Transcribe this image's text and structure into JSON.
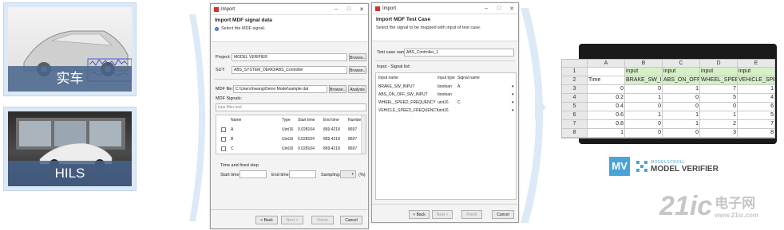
{
  "left": {
    "car_caption": "实车",
    "hils_caption": "HILS"
  },
  "dialog1": {
    "title": "Import",
    "header_title": "Import MDF signal data",
    "header_msg": "Select the MDF signal.",
    "project_label": "Project:",
    "project_value": "MODEL VERIFIER",
    "sut_label": "SUT:",
    "sut_value": "ABS_SYSTEM_DEMO/ABS_Controller",
    "browse1": "Browse...",
    "browse2": "Browse...",
    "mdf_file_label": "MDF file:",
    "mdf_file_value": "C:\\Users\\hwang\\Demo Model\\sample.dat",
    "browse3": "Browse...",
    "analysis": "Analysis",
    "mdf_signals_label": "MDF Signals:",
    "filter_placeholder": "type filter text",
    "columns": [
      "Name",
      "Type",
      "Start time",
      "End time",
      "Number"
    ],
    "rows": [
      [
        "A",
        "Uint16",
        "0.028104",
        "869.4218",
        "8697"
      ],
      [
        "B",
        "Uint16",
        "0.028104",
        "869.4218",
        "8697"
      ],
      [
        "C",
        "Uint16",
        "0.028104",
        "869.4218",
        "8697"
      ]
    ],
    "time_section": "Time and fixed step",
    "start_time_label": "Start time:",
    "end_time_label": "End time:",
    "sampling_label": "Sampling:",
    "sampling_unit": "(%)",
    "back": "< Back",
    "next": "Next >",
    "finish": "Finish",
    "cancel": "Cancel"
  },
  "dialog2": {
    "title": "Import",
    "header_title": "Import MDF Test Case",
    "header_msg": "Select the signal to be mapped with input of test case.",
    "test_case_label": "Test case name:",
    "test_case_value": "ABS_Controller_1",
    "section": "Input - Signal list:",
    "columns": [
      "Input name",
      "Input type",
      "Signal name"
    ],
    "rows": [
      [
        "BRAKE_SW_INPUT",
        "boolean",
        "A"
      ],
      [
        "ABS_ON_OFF_SW_INPUT",
        "boolean",
        ""
      ],
      [
        "WHEEL_SPEED_FREQUENCY",
        "uint16",
        "C"
      ],
      [
        "VEHICLE_SPEED_FREQUENCY",
        "uint16",
        ""
      ]
    ],
    "back": "< Back",
    "next": "Next >",
    "finish": "Finish",
    "cancel": "Cancel"
  },
  "sheet": {
    "col_headers": [
      "A",
      "B",
      "C",
      "D",
      "E"
    ],
    "row_numbers": [
      "1",
      "2",
      "3",
      "4",
      "5",
      "6",
      "7",
      "8"
    ],
    "rows": [
      [
        "",
        "input",
        "input",
        "input",
        "input"
      ],
      [
        "Time",
        "BRAKE_SW_INPUT",
        "ABS_ON_OFF_SW",
        "WHEEL_SPEED_FR",
        "VEHICLE_SPEED_"
      ],
      [
        "0",
        "0",
        "1",
        "7",
        "1"
      ],
      [
        "0.2",
        "1",
        "0",
        "5",
        "4"
      ],
      [
        "0.4",
        "0",
        "0",
        "0",
        "6"
      ],
      [
        "0.6",
        "1",
        "1",
        "1",
        "5"
      ],
      [
        "0.8",
        "0",
        "1",
        "2",
        "7"
      ],
      [
        "1",
        "0",
        "0",
        "3",
        "8"
      ]
    ]
  },
  "brand": {
    "mv": "MV",
    "small": "MODELSCROLL",
    "name": "MODEL VERIFIER",
    "accent": "#4aa3d6"
  },
  "watermark": {
    "main": "21ic",
    "cn": "电子网",
    "url": "www.21ic.com"
  }
}
